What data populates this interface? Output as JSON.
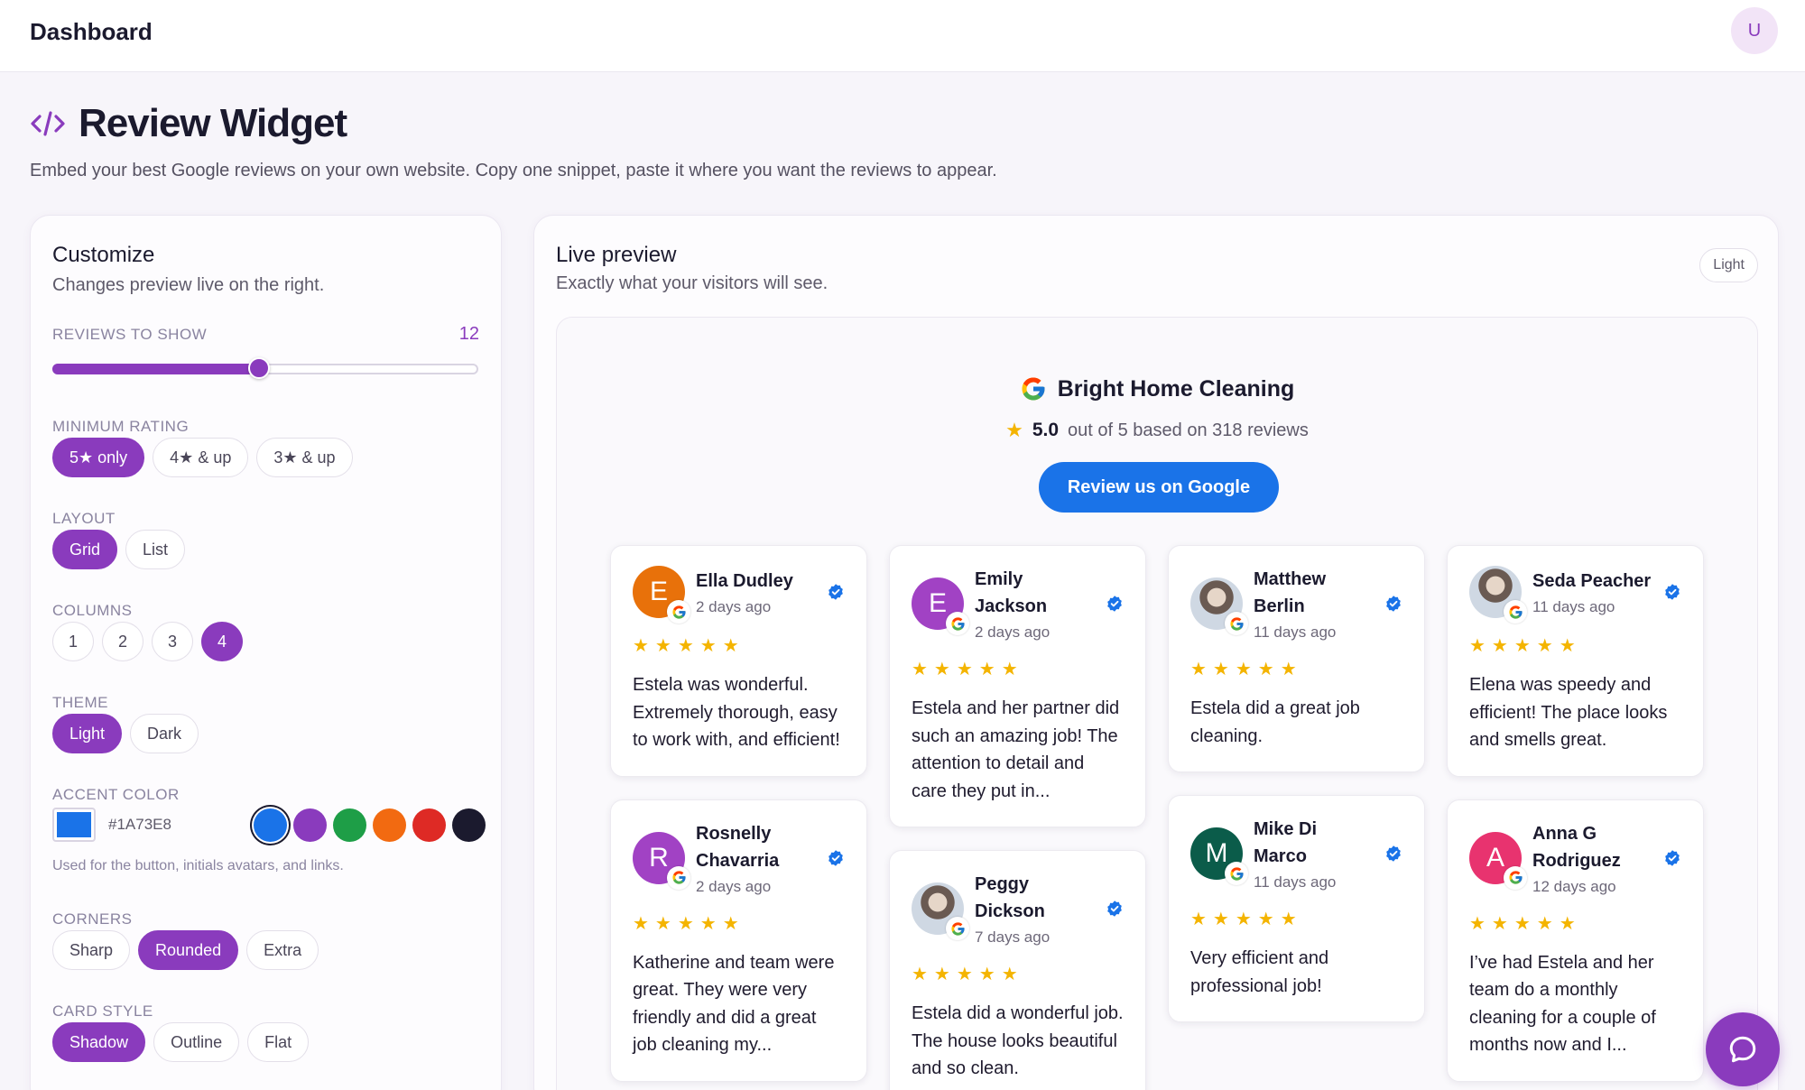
{
  "app": {
    "title": "Dashboard",
    "user_initial": "U"
  },
  "page": {
    "title": "Review Widget",
    "subtitle": "Embed your best Google reviews on your own website. Copy one snippet, paste it where you want the reviews to appear."
  },
  "customize": {
    "title": "Customize",
    "subtitle": "Changes preview live on the right.",
    "reviews_to_show": {
      "label": "REVIEWS TO SHOW",
      "value": "12",
      "fraction": 0.48
    },
    "min_rating": {
      "label": "MINIMUM RATING",
      "options": [
        "5★ only",
        "4★ & up",
        "3★ & up"
      ],
      "selected": "5★ only"
    },
    "layout": {
      "label": "LAYOUT",
      "options": [
        "Grid",
        "List"
      ],
      "selected": "Grid"
    },
    "columns": {
      "label": "COLUMNS",
      "options": [
        "1",
        "2",
        "3",
        "4"
      ],
      "selected": "4"
    },
    "theme": {
      "label": "THEME",
      "options": [
        "Light",
        "Dark"
      ],
      "selected": "Light"
    },
    "accent_color": {
      "label": "ACCENT COLOR",
      "hex": "#1A73E8",
      "swatches": [
        "#1a73e8",
        "#8a3bbd",
        "#1e9e47",
        "#f26a11",
        "#de2a25",
        "#1b1a2e"
      ],
      "hint": "Used for the button, initials avatars, and links."
    },
    "corners": {
      "label": "CORNERS",
      "options": [
        "Sharp",
        "Rounded",
        "Extra"
      ],
      "selected": "Rounded"
    },
    "card_style": {
      "label": "CARD STYLE",
      "options": [
        "Shadow",
        "Outline",
        "Flat"
      ],
      "selected": "Shadow"
    }
  },
  "preview": {
    "title": "Live preview",
    "subtitle": "Exactly what your visitors will see.",
    "theme_badge": "Light",
    "widget": {
      "business_name": "Bright Home Cleaning",
      "rating": "5.0",
      "rating_text": "out of 5 based on 318 reviews",
      "button_label": "Review us on Google"
    },
    "columns": {
      "c1": [
        {
          "name": "Ella Dudley",
          "time": "2 days ago",
          "initial": "E",
          "color": "#e8710a",
          "stars": "★★★★★",
          "text": "Estela was wonderful. Extremely thorough, easy to work with, and efficient!"
        },
        {
          "name": "Rosnelly Chavarria",
          "time": "2 days ago",
          "initial": "R",
          "color": "#a142c4",
          "stars": "★★★★★",
          "text": "Katherine and team were great. They were very friendly and did a great job cleaning my..."
        }
      ],
      "c2": [
        {
          "name": "Emily Jackson",
          "time": "2 days ago",
          "initial": "E",
          "color": "#a142c4",
          "stars": "★★★★★",
          "text": "Estela and her partner did such an amazing job! The attention to detail and care they put in..."
        },
        {
          "name": "Peggy Dickson",
          "time": "7 days ago",
          "initial": "",
          "color": "photo",
          "stars": "★★★★★",
          "text": "Estela did a wonderful job. The house looks beautiful and so clean."
        }
      ],
      "c3": [
        {
          "name": "Matthew Berlin",
          "time": "11 days ago",
          "initial": "",
          "color": "photo",
          "stars": "★★★★★",
          "text": "Estela did a great job cleaning."
        },
        {
          "name": "Mike Di Marco",
          "time": "11 days ago",
          "initial": "M",
          "color": "#0b5c4a",
          "stars": "★★★★★",
          "text": "Very efficient and professional job!"
        }
      ],
      "c4": [
        {
          "name": "Seda Peacher",
          "time": "11 days ago",
          "initial": "",
          "color": "photo",
          "stars": "★★★★★",
          "text": "Elena was speedy and efficient! The place looks and smells great."
        },
        {
          "name": "Anna G Rodriguez",
          "time": "12 days ago",
          "initial": "A",
          "color": "#e8336f",
          "stars": "★★★★★",
          "text": "I’ve had Estela and her team do a monthly cleaning for a couple of months now and I..."
        }
      ]
    }
  }
}
